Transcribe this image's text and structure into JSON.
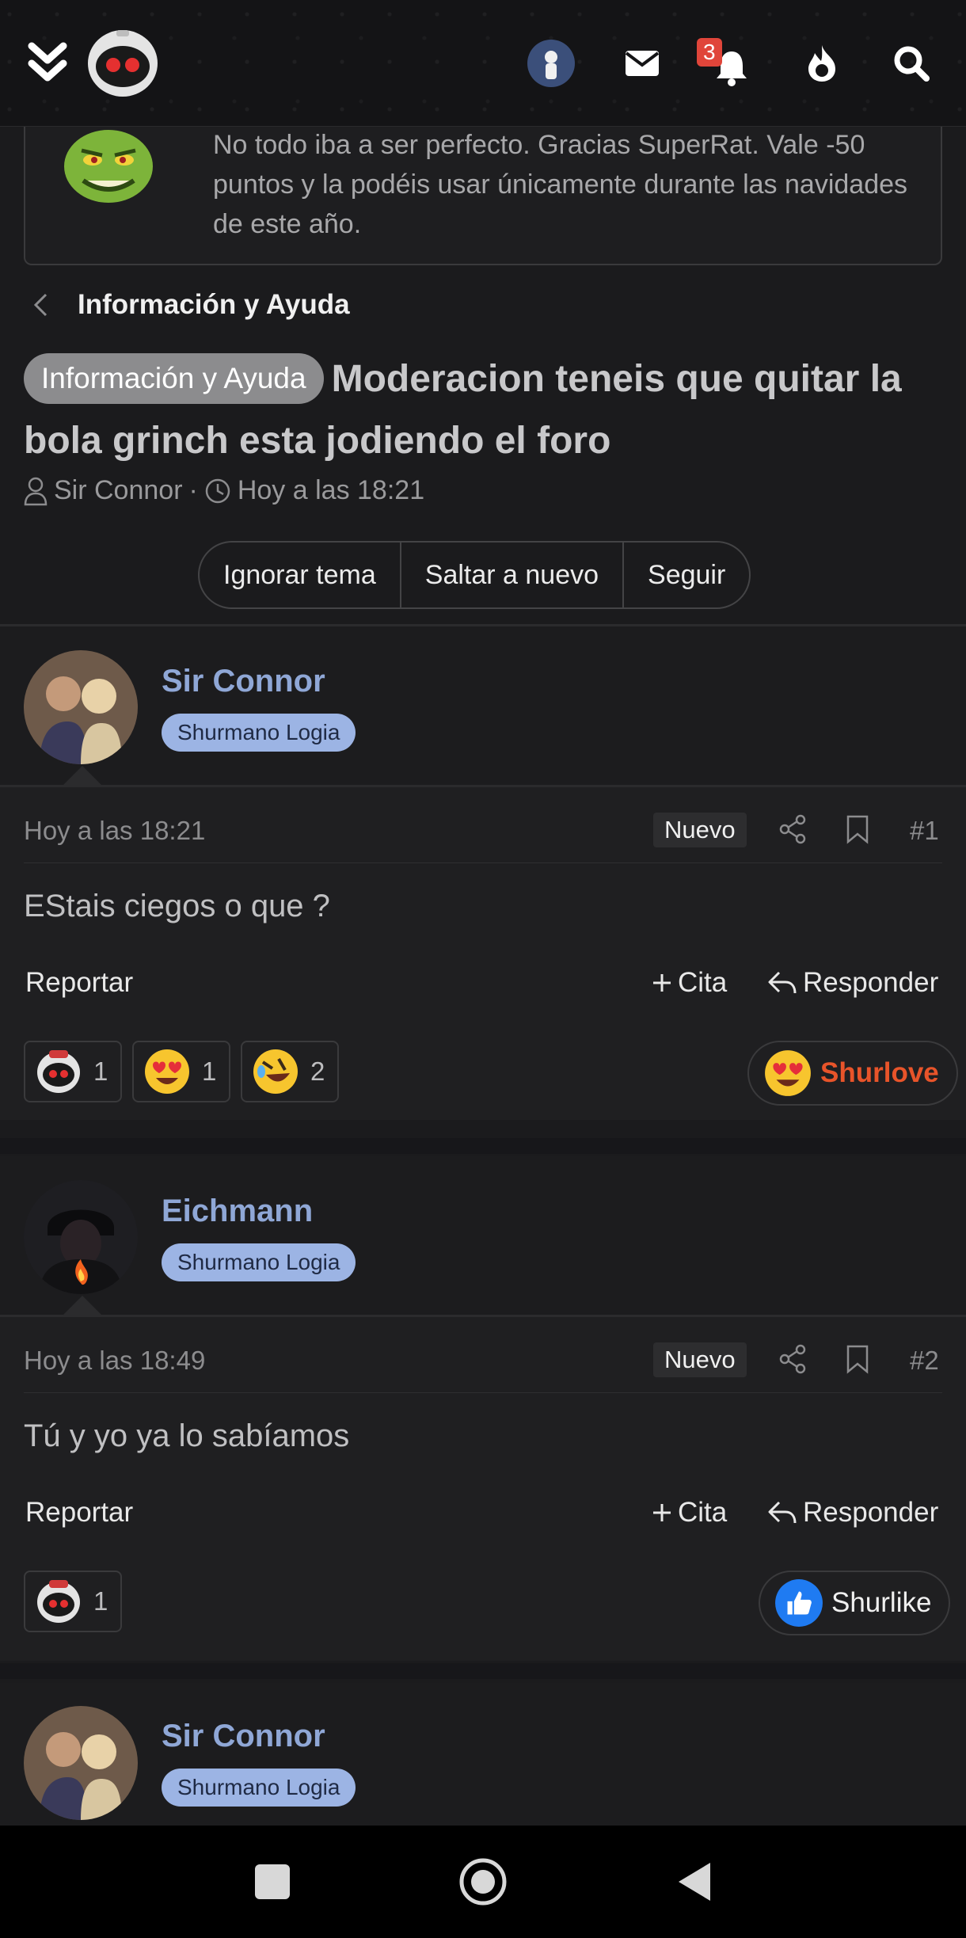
{
  "topbar": {
    "notifications_count": "3"
  },
  "notice": {
    "text": "No todo iba a ser perfecto. Gracias SuperRat. Vale -50 puntos y la podéis usar únicamente durante las navidades de este año."
  },
  "breadcrumb": {
    "label": "Información y Ayuda"
  },
  "thread": {
    "prefix": "Información y Ayuda",
    "title": "Moderacion teneis que quitar la bola grinch esta jodiendo el foro",
    "author": "Sir Connor",
    "time": "Hoy a las 18:21"
  },
  "actions": {
    "ignore": "Ignorar tema",
    "jump": "Saltar a nuevo",
    "follow": "Seguir"
  },
  "labels": {
    "report": "Reportar",
    "quote": "Cita",
    "reply": "Responder",
    "new": "Nuevo"
  },
  "posts": [
    {
      "username": "Sir Connor",
      "usertag": "Shurmano Logia",
      "time": "Hoy a las 18:21",
      "number": "#1",
      "text": "EStais ciegos o que ?",
      "reactions": [
        {
          "icon": "robot-emoji",
          "count": "1"
        },
        {
          "icon": "heart-eyes-emoji",
          "count": "1"
        },
        {
          "icon": "rofl-emoji",
          "count": "2"
        }
      ],
      "react_button": "Shurlove"
    },
    {
      "username": "Eichmann",
      "usertag": "Shurmano Logia",
      "time": "Hoy a las 18:49",
      "number": "#2",
      "text": "Tú y yo ya lo sabíamos",
      "reactions": [
        {
          "icon": "robot-emoji",
          "count": "1"
        }
      ],
      "react_button": "Shurlike"
    },
    {
      "username": "Sir Connor",
      "usertag": "Shurmano Logia"
    }
  ],
  "colors": {
    "accent_username": "#8fa7d6",
    "usertag_bg": "#9cb4e4",
    "shurlove": "#e8542a",
    "notif_badge": "#e0453a"
  }
}
